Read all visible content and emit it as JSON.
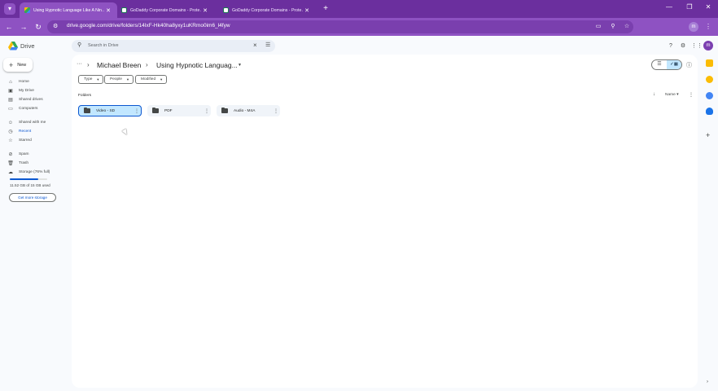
{
  "browser": {
    "tabs": [
      {
        "title": "Using Hypnotic Language Like A Nin…",
        "active": true,
        "favicon": "drive-favicon"
      },
      {
        "title": "GoDaddy Corporate Domains - Prote…",
        "active": false,
        "favicon": "godaddy-favicon"
      },
      {
        "title": "GoDaddy Corporate Domains - Prote…",
        "active": false,
        "favicon": "godaddy-favicon"
      }
    ],
    "url": "drive.google.com/drive/folders/14IxF-Hk40ha8yxy1uKRmo0im6_l4fyw",
    "profile_initial": "m",
    "accent": "#8e52c2"
  },
  "drive": {
    "app_name": "Drive",
    "search_placeholder": "Search in Drive",
    "avatar_initial": "m",
    "new_label": "New",
    "nav": [
      {
        "label": "Home",
        "icon": "home-icon",
        "glyph": "⌂"
      },
      {
        "label": "My Drive",
        "icon": "my-drive-icon",
        "glyph": "▣"
      },
      {
        "label": "Shared drives",
        "icon": "shared-drives-icon",
        "glyph": "▤"
      },
      {
        "label": "Computers",
        "icon": "computer-icon",
        "glyph": "▭"
      },
      {
        "label": "Shared with me",
        "icon": "shared-with-me-icon",
        "glyph": "☺"
      },
      {
        "label": "Recent",
        "icon": "clock-icon",
        "glyph": "◷",
        "highlight": true
      },
      {
        "label": "Starred",
        "icon": "star-icon",
        "glyph": "☆"
      },
      {
        "label": "Spam",
        "icon": "spam-icon",
        "glyph": "⊘"
      },
      {
        "label": "Trash",
        "icon": "trash-icon",
        "glyph": "🗑"
      },
      {
        "label": "Storage (76% full)",
        "icon": "cloud-icon",
        "glyph": "☁"
      }
    ],
    "storage_used": "11.52 GB of 15 GB used",
    "storage_fraction": 0.76,
    "get_storage_label": "Get more storage",
    "breadcrumb": {
      "more": "···",
      "parent": "Michael Breen",
      "current": "Using Hypnotic Languag..."
    },
    "filters": [
      "Type",
      "People",
      "Modified"
    ],
    "section_title": "Folders",
    "sort_label": "Name",
    "folders": [
      {
        "name": "Video - SD",
        "selected": true
      },
      {
        "name": "PDF",
        "selected": false
      },
      {
        "name": "Audio - M4A",
        "selected": false
      }
    ]
  }
}
